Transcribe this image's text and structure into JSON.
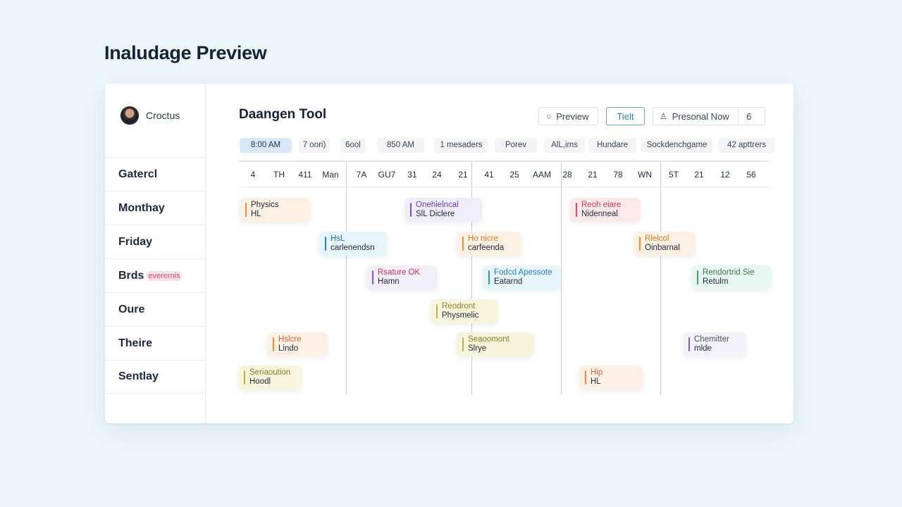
{
  "page_title": "Inaludage Preview",
  "sidebar": {
    "user_name": "Croctus",
    "items": [
      {
        "label": "Gatercl",
        "tag": ""
      },
      {
        "label": "Monthay",
        "tag": ""
      },
      {
        "label": "Friday",
        "tag": ""
      },
      {
        "label": "Brds",
        "tag": "everernis"
      },
      {
        "label": "Oure",
        "tag": ""
      },
      {
        "label": "Theire",
        "tag": ""
      },
      {
        "label": "Sentlay",
        "tag": ""
      }
    ]
  },
  "main": {
    "title": "Daangen Tool",
    "actions": {
      "preview_label": "Preview",
      "preview_icon": "circle-icon",
      "tielt_label": "Tielt",
      "personal_label": "Presonal Now",
      "personal_icon": "person-icon",
      "extra_label": "6"
    },
    "filters": [
      {
        "label": "8:00 AM",
        "selected": true
      },
      {
        "label": "7 oori)",
        "selected": false
      },
      {
        "label": "6ool",
        "selected": false
      },
      {
        "label": "850 AM",
        "selected": false
      },
      {
        "label": "1 mesaders",
        "selected": false
      },
      {
        "label": "Porev",
        "selected": false
      },
      {
        "label": "AlL,ims",
        "selected": false
      },
      {
        "label": "Hundare",
        "selected": false
      },
      {
        "label": "Sockdenchgame",
        "selected": false
      },
      {
        "label": "42 apttrers",
        "selected": false
      }
    ],
    "columns": [
      "4",
      "TH",
      "411",
      "Man",
      "7A",
      "GU7",
      "31",
      "24",
      "21",
      "41",
      "25",
      "AAM",
      "28",
      "21",
      "78",
      "WN",
      "5T",
      "21",
      "12",
      "56"
    ],
    "events": [
      {
        "line1": "Physics",
        "line2": "HL",
        "color": "#f08a3c",
        "bg": "#fdf1e4",
        "text1": "#1e2838"
      },
      {
        "line1": "Onehielncal",
        "line2": "SlL Diclere",
        "color": "#7b4fc8",
        "bg": "#f1ecfa",
        "text1": "#6a3fb8"
      },
      {
        "line1": "Reoh eiare",
        "line2": "Nidenneal",
        "color": "#e34b5e",
        "bg": "#fde8ea",
        "text1": "#d63a55"
      },
      {
        "line1": "HsL",
        "line2": "carlenendsn",
        "color": "#2f7fc4",
        "bg": "#e6f5fb",
        "text1": "#2472b8"
      },
      {
        "line1": "Ho nicre",
        "line2": "carfeenda",
        "color": "#f08a3c",
        "bg": "#fdf1e4",
        "text1": "#e07a2a"
      },
      {
        "line1": "Rlelcol",
        "line2": "Oinbarnal",
        "color": "#f08a3c",
        "bg": "#fdf1e4",
        "text1": "#e07a2a"
      },
      {
        "line1": "Rsature OK",
        "line2": "Hamn",
        "color": "#8a55c8",
        "bg": "#f2eefa",
        "text1": "#c8344f"
      },
      {
        "line1": "Fodcd Apessote",
        "line2": "Eatarnd",
        "color": "#2f8fc9",
        "bg": "#e6f5fb",
        "text1": "#2a7fc0"
      },
      {
        "line1": "Rendortrid Sie",
        "line2": "Retulm",
        "color": "#4a9a54",
        "bg": "#e9f7f3",
        "text1": "#3b7a45"
      },
      {
        "line1": "Reodront",
        "line2": "Physmelic",
        "color": "#b8b04a",
        "bg": "#f7f5dc",
        "text1": "#8a8330"
      },
      {
        "line1": "Hslcre",
        "line2": "Lindo",
        "color": "#f08a3c",
        "bg": "#fdf0e4",
        "text1": "#e0662a"
      },
      {
        "line1": "Seaoomont",
        "line2": "Slrye",
        "color": "#b8b04a",
        "bg": "#f6f4db",
        "text1": "#857e2a"
      },
      {
        "line1": "Chemitter",
        "line2": "mlde",
        "color": "#7a5fb8",
        "bg": "#f3f1f9",
        "text1": "#4a4f6a"
      },
      {
        "line1": "Seriaoution",
        "line2": "Hoodl",
        "color": "#b8b04a",
        "bg": "#f7f5dc",
        "text1": "#857e2a"
      },
      {
        "line1": "Hip",
        "line2": "HL",
        "color": "#f08a3c",
        "bg": "#fdf0e4",
        "text1": "#e0662a"
      }
    ]
  }
}
